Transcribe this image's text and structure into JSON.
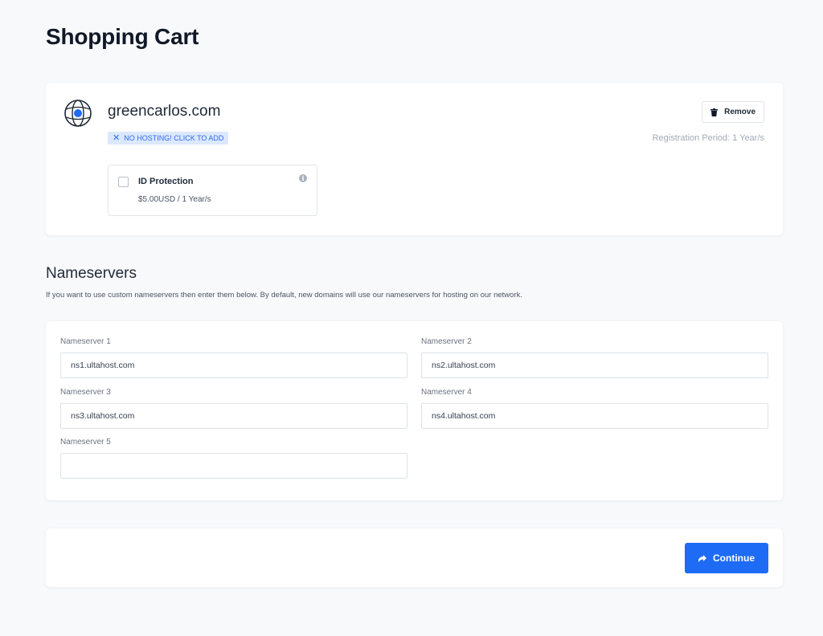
{
  "page": {
    "title": "Shopping Cart"
  },
  "cart_item": {
    "domain": "greencarlos.com",
    "hosting_badge": "NO HOSTING! CLICK TO ADD",
    "remove_label": "Remove",
    "registration_period": "Registration Period: 1 Year/s",
    "addon": {
      "name": "ID Protection",
      "price": "$5.00USD / 1 Year/s",
      "checked": false
    }
  },
  "nameservers": {
    "heading": "Nameservers",
    "description": "If you want to use custom nameservers then enter them below. By default, new domains will use our nameservers for hosting on our network.",
    "fields": [
      {
        "label": "Nameserver 1",
        "value": "ns1.ultahost.com"
      },
      {
        "label": "Nameserver 2",
        "value": "ns2.ultahost.com"
      },
      {
        "label": "Nameserver 3",
        "value": "ns3.ultahost.com"
      },
      {
        "label": "Nameserver 4",
        "value": "ns4.ultahost.com"
      },
      {
        "label": "Nameserver 5",
        "value": ""
      }
    ]
  },
  "actions": {
    "continue_label": "Continue"
  },
  "colors": {
    "accent": "#1e6bf5",
    "badge_bg": "#dbe8ff",
    "badge_text": "#2f6bef",
    "muted_text": "#a3aab7"
  },
  "icons": {
    "domain": "globe-icon",
    "badge": "close-icon",
    "remove": "trash-icon",
    "addon_info": "info-icon",
    "continue": "arrow-right-icon"
  }
}
